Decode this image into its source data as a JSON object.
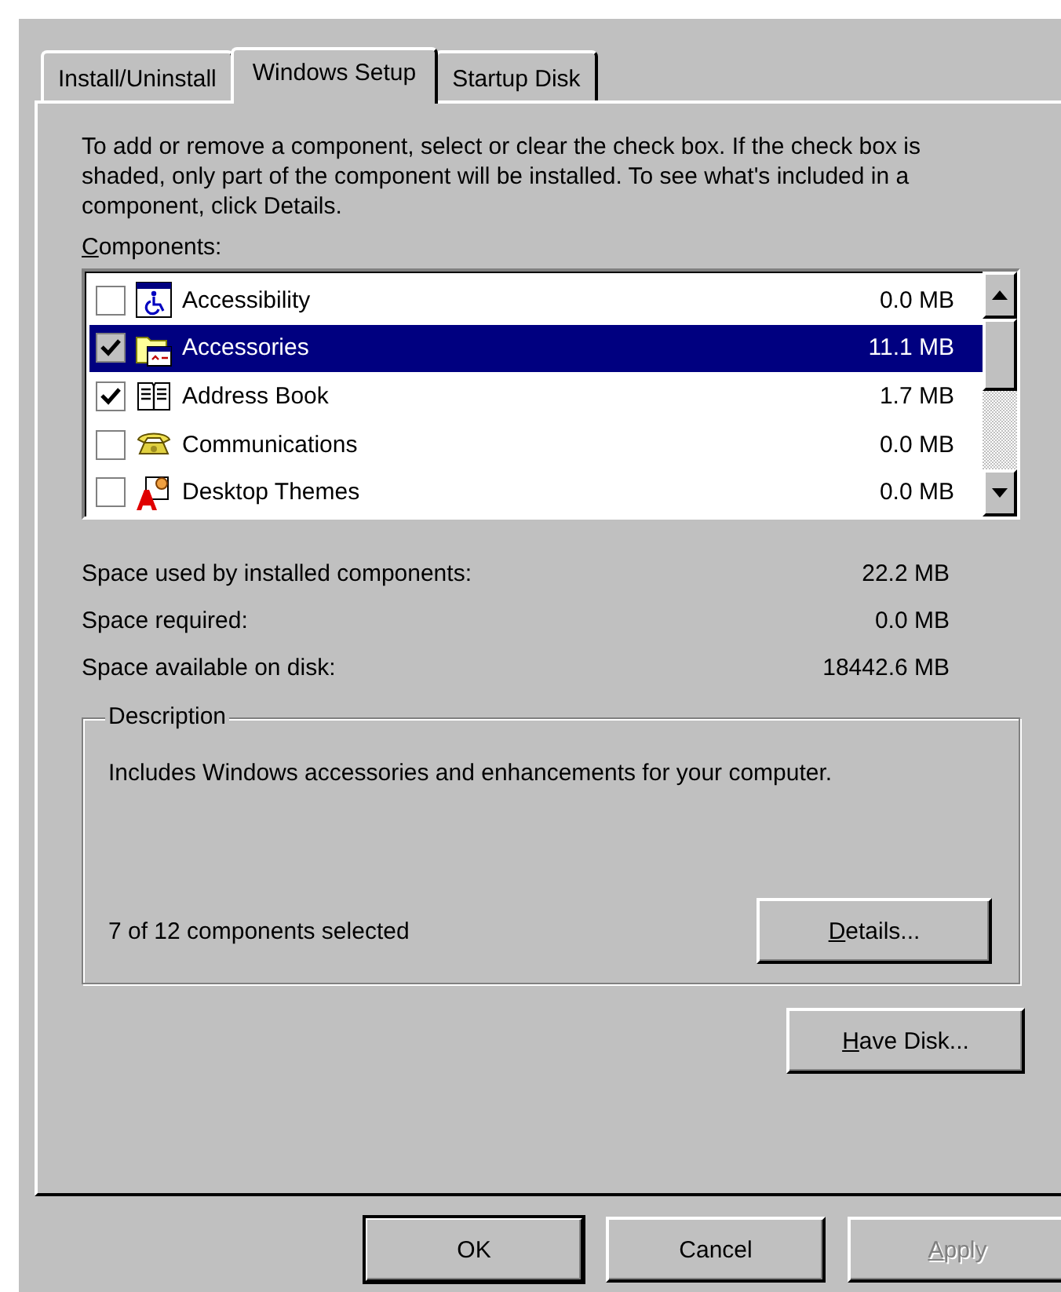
{
  "tabs": [
    {
      "label": "Install/Uninstall",
      "selected": false
    },
    {
      "label": "Windows Setup",
      "selected": true
    },
    {
      "label": "Startup Disk",
      "selected": false
    }
  ],
  "instructions": "To add or remove a component, select or clear the check box. If the check box is shaded, only part of the component will be installed. To see what's included in a component, click Details.",
  "components_label": {
    "access_key": "C",
    "rest": "omponents:"
  },
  "components": [
    {
      "kind": "accessibility",
      "name": "Accessibility",
      "size": "0.0 MB",
      "checked": false,
      "selected": false
    },
    {
      "kind": "accessories",
      "name": "Accessories",
      "size": "11.1 MB",
      "checked": true,
      "selected": true
    },
    {
      "kind": "address-book",
      "name": "Address Book",
      "size": "1.7 MB",
      "checked": true,
      "selected": false
    },
    {
      "kind": "communications",
      "name": "Communications",
      "size": "0.0 MB",
      "checked": false,
      "selected": false
    },
    {
      "kind": "desktop-themes",
      "name": "Desktop Themes",
      "size": "0.0 MB",
      "checked": false,
      "selected": false
    }
  ],
  "space": [
    {
      "label": "Space used by installed components:",
      "value": "22.2 MB"
    },
    {
      "label": "Space required:",
      "value": "0.0 MB"
    },
    {
      "label": "Space available on disk:",
      "value": "18442.6 MB"
    }
  ],
  "description": {
    "title": "Description",
    "text": "Includes Windows accessories and enhancements for your computer.",
    "count": "7 of 12 components selected",
    "details_button": {
      "access_key": "D",
      "rest": "etails..."
    }
  },
  "have_disk_button": {
    "access_key": "H",
    "rest": "ave Disk..."
  },
  "buttons": [
    {
      "rest": "OK",
      "default": true,
      "disabled": false
    },
    {
      "rest": "Cancel",
      "default": false,
      "disabled": false
    },
    {
      "access_key": "A",
      "rest": "pply",
      "default": false,
      "disabled": true
    }
  ]
}
